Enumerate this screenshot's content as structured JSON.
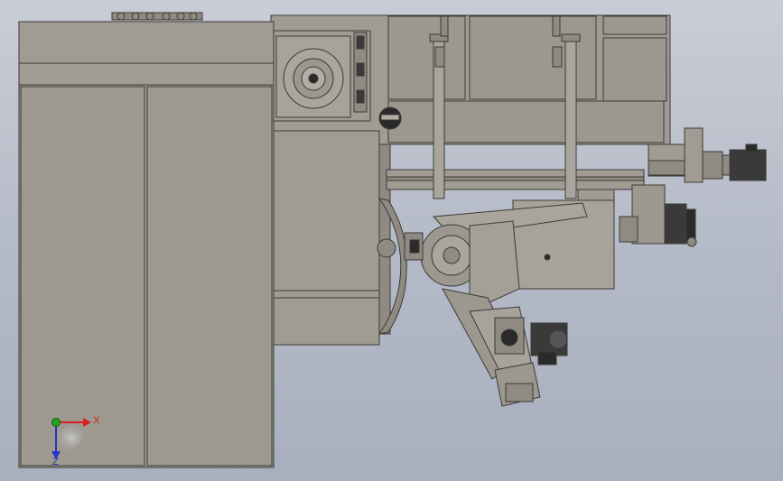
{
  "triad": {
    "x_label": "X",
    "z_label": "Z",
    "x_color": "#d81e1e",
    "z_color": "#2432c8",
    "y_color": "#1fa21f"
  },
  "colors": {
    "body_fill": "#a09c94",
    "body_stroke": "#3c3a36",
    "accent_dark": "#2a2a2a",
    "motor_fill": "#3a3a3a"
  }
}
